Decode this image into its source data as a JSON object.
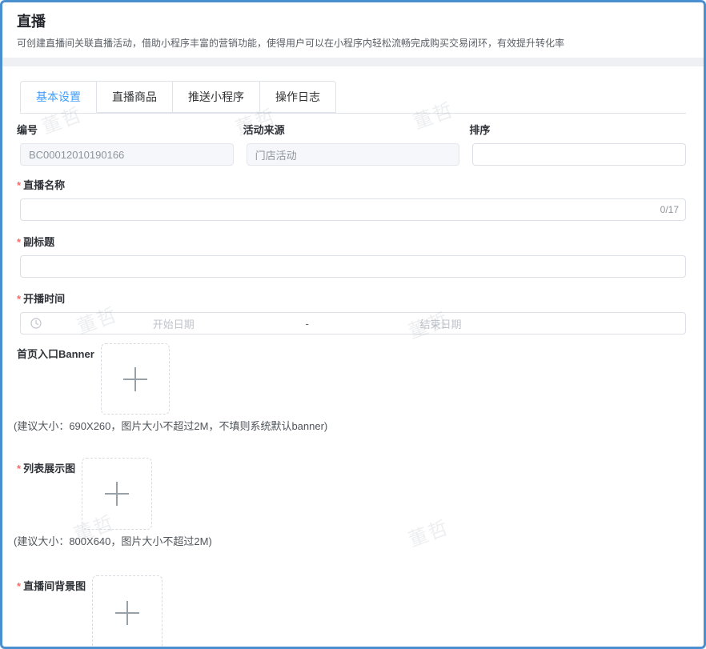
{
  "page": {
    "title": "直播",
    "description": "可创建直播间关联直播活动，借助小程序丰富的营销功能，使得用户可以在小程序内轻松流畅完成购买交易闭环，有效提升转化率"
  },
  "colors": {
    "accent": "#409eff",
    "page_border": "#4a8fd0",
    "required_mark": "#f56c6c",
    "disabled_bg": "#f5f7fa"
  },
  "watermark": {
    "text": "董哲"
  },
  "tabs": [
    {
      "label": "基本设置",
      "active": true
    },
    {
      "label": "直播商品",
      "active": false
    },
    {
      "label": "推送小程序",
      "active": false
    },
    {
      "label": "操作日志",
      "active": false
    }
  ],
  "form": {
    "fields": {
      "code": {
        "label": "编号",
        "value": "BC00012010190166",
        "disabled": true
      },
      "source": {
        "label": "活动来源",
        "value": "门店活动",
        "disabled": true
      },
      "sort": {
        "label": "排序",
        "value": ""
      },
      "name": {
        "label": "直播名称",
        "required": true,
        "value": "",
        "counter": "0/17"
      },
      "subtitle": {
        "label": "副标题",
        "required": true,
        "value": ""
      },
      "time": {
        "label": "开播时间",
        "required": true,
        "start_placeholder": "开始日期",
        "separator": "-",
        "end_placeholder": "结束日期"
      },
      "banner": {
        "label": "首页入口Banner",
        "required": false,
        "hint": "(建议大小：690X260，图片大小不超过2M，不填则系统默认banner)"
      },
      "list_image": {
        "label": "列表展示图",
        "required": true,
        "hint": "(建议大小：800X640，图片大小不超过2M)"
      },
      "bg_image": {
        "label": "直播间背景图",
        "required": true
      }
    }
  },
  "icons": {
    "date_picker": "clock",
    "upload": "plus"
  }
}
